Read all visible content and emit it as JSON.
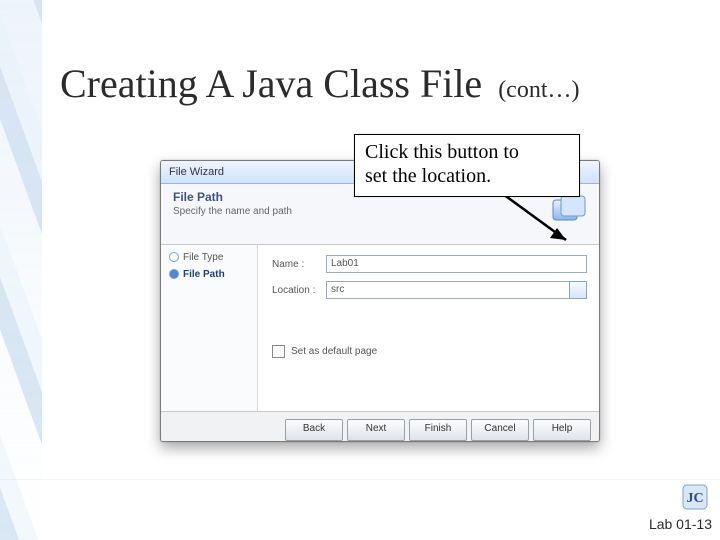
{
  "slide": {
    "title_main": "Creating A Java Class File",
    "title_sub": "(cont…)",
    "footer": "Lab 01-13",
    "logo_text": "JC"
  },
  "callout": {
    "line1": "Click this button to",
    "line2": "set the location."
  },
  "wizard": {
    "window_title": "File Wizard",
    "heading": "File Path",
    "sub_heading": "Specify the name and path",
    "nav": {
      "step1": "File Type",
      "step2": "File Path"
    },
    "form": {
      "name_label": "Name :",
      "name_value": "Lab01",
      "loc_label": "Location :",
      "loc_value": "src",
      "default_label": "Set as default page"
    },
    "buttons": {
      "back": "Back",
      "next": "Next",
      "finish": "Finish",
      "cancel": "Cancel",
      "help": "Help"
    }
  }
}
